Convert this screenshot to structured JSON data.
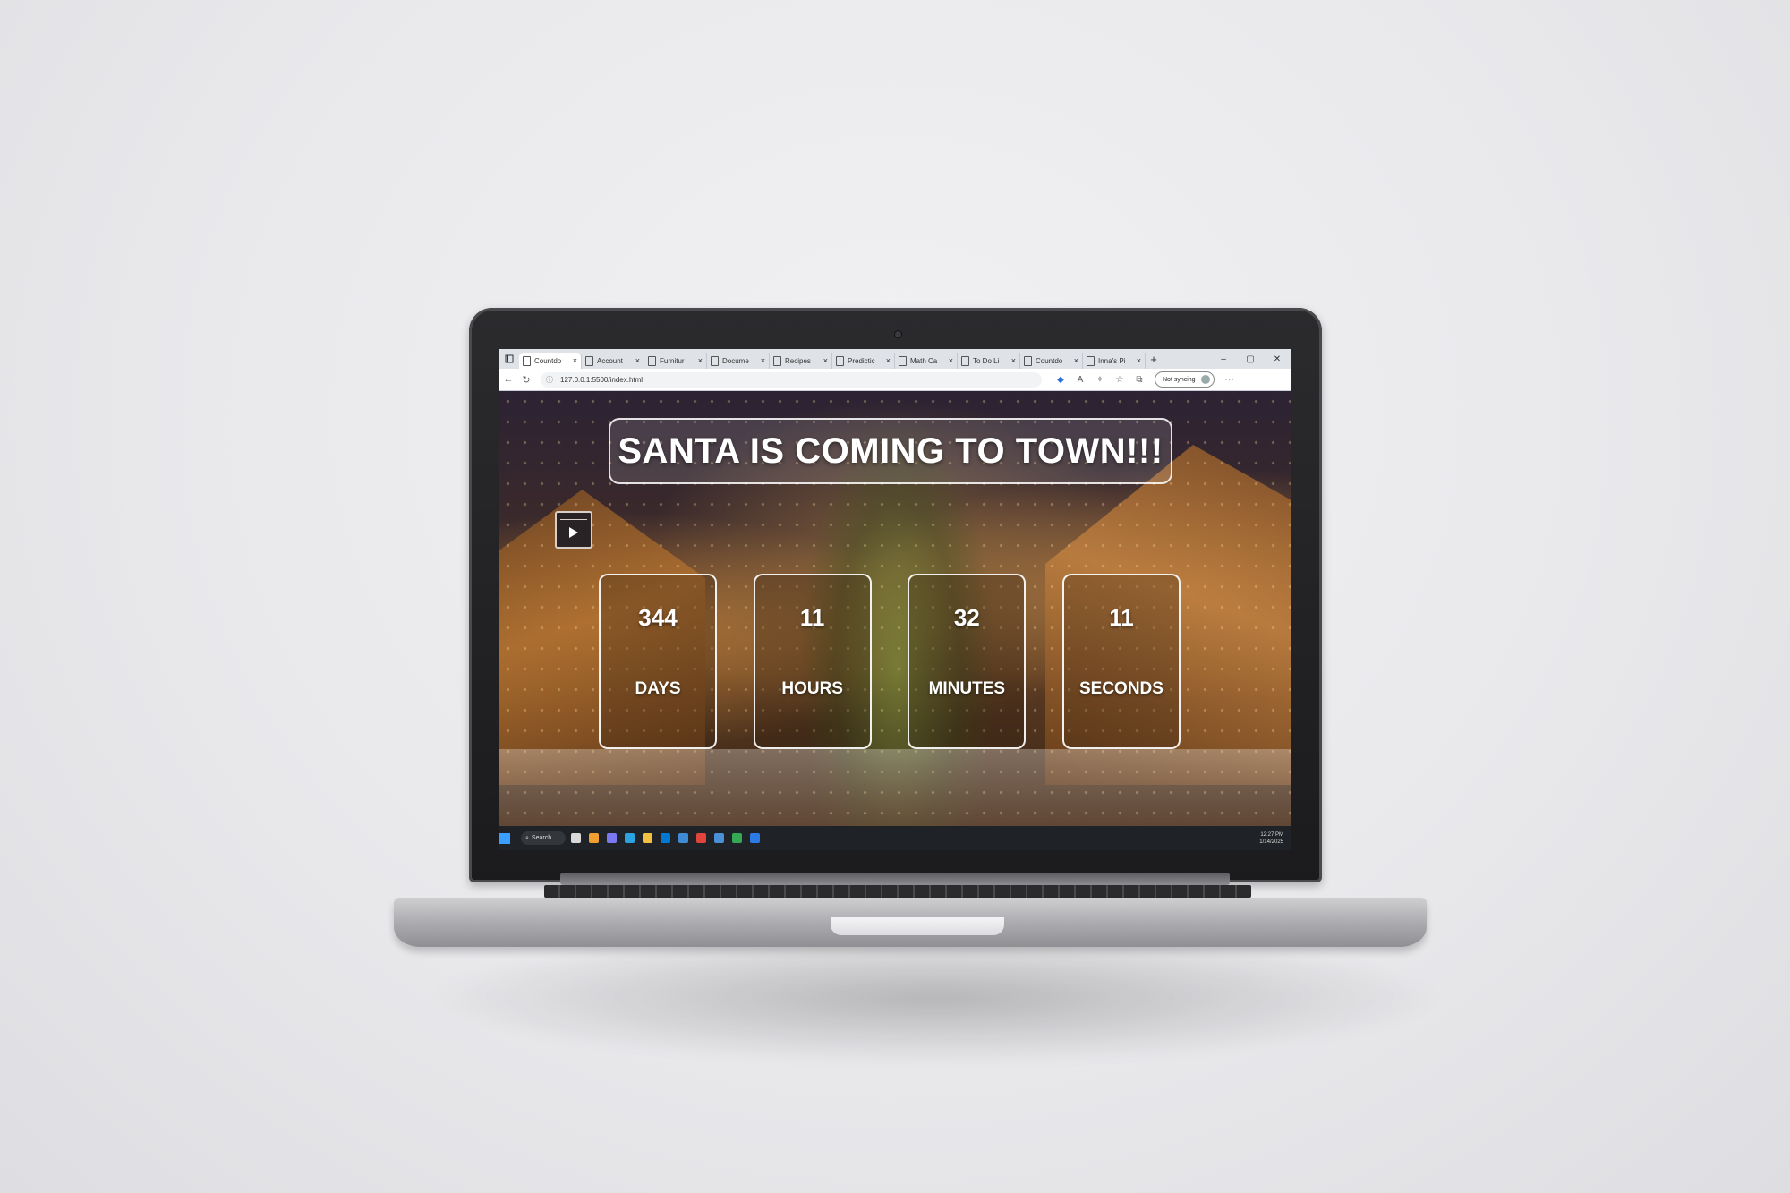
{
  "browser": {
    "tabs": [
      {
        "label": "Countdo",
        "active": true
      },
      {
        "label": "Account",
        "active": false
      },
      {
        "label": "Furnitur",
        "active": false
      },
      {
        "label": "Docume",
        "active": false
      },
      {
        "label": "Recipes",
        "active": false
      },
      {
        "label": "Predictic",
        "active": false
      },
      {
        "label": "Math Ca",
        "active": false
      },
      {
        "label": "To Do Li",
        "active": false
      },
      {
        "label": "Countdo",
        "active": false
      },
      {
        "label": "Inna's Pi",
        "active": false
      }
    ],
    "tab_close_glyph": "×",
    "new_tab_glyph": "+",
    "url": "127.0.0.1:5500/index.html",
    "sync_label": "Not syncing",
    "more_glyph": "···"
  },
  "page": {
    "title": "SANTA IS COMING TO TOWN!!!",
    "countdown": [
      {
        "value": "344",
        "label": "DAYS"
      },
      {
        "value": "11",
        "label": "HOURS"
      },
      {
        "value": "32",
        "label": "MINUTES"
      },
      {
        "value": "11",
        "label": "SECONDS"
      }
    ]
  },
  "taskbar": {
    "search_label": "Search",
    "clock_time": "12:27 PM",
    "clock_date": "1/14/2025",
    "app_colors": [
      "#d9d9d9",
      "#f0a030",
      "#7a7af0",
      "#2aa3e0",
      "#f2c040",
      "#0078d4",
      "#3f8bd6",
      "#e0443a",
      "#4a90d9",
      "#34a853",
      "#2c7be5"
    ]
  }
}
